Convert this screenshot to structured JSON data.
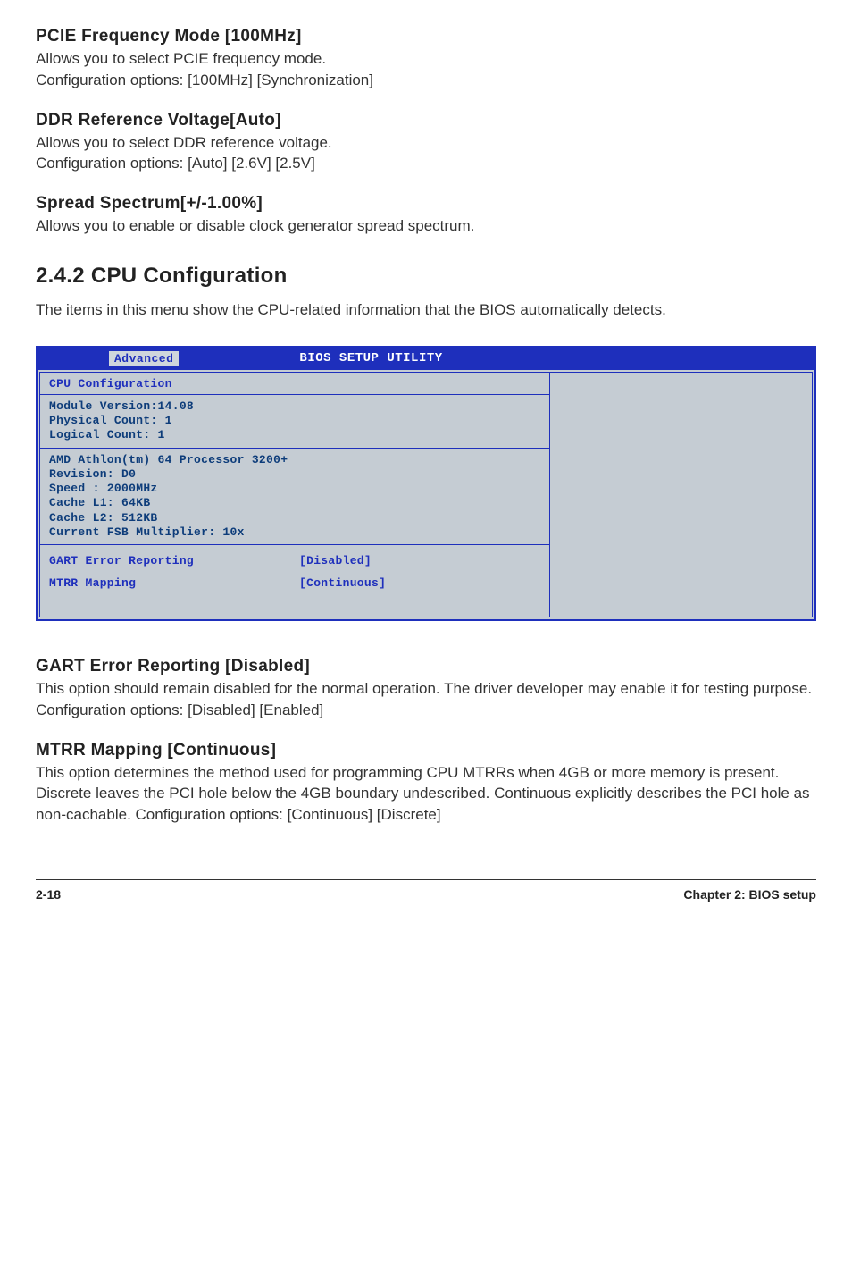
{
  "pcie": {
    "heading": "PCIE Frequency Mode [100MHz]",
    "body1": "Allows you to select PCIE frequency mode.",
    "body2": "Configuration options: [100MHz] [Synchronization]"
  },
  "ddr": {
    "heading": "DDR Reference Voltage[Auto]",
    "body1": "Allows you to select DDR reference voltage.",
    "body2": "Configuration options: [Auto] [2.6V] [2.5V]"
  },
  "spread": {
    "heading": "Spread Spectrum[+/-1.00%]",
    "body1": "Allows you to enable or disable clock generator spread spectrum."
  },
  "cpu_config": {
    "heading": "2.4.2   CPU Configuration",
    "body": "The items in this menu show the CPU-related information that the BIOS automatically detects."
  },
  "bios": {
    "tab": "Advanced",
    "title": "BIOS SETUP UTILITY",
    "panel_title": "CPU Configuration",
    "module_line1": "Module Version:14.08",
    "module_line2": "Physical Count: 1",
    "module_line3": "Logical Count: 1",
    "proc_line1": "AMD Athlon(tm) 64 Processor 3200+",
    "proc_line2": "Revision: D0",
    "proc_line3": "Speed   : 2000MHz",
    "proc_line4": "Cache L1: 64KB",
    "proc_line5": "Cache L2: 512KB",
    "proc_line6": "Current FSB Multiplier: 10x",
    "setting1_label": "GART Error Reporting",
    "setting1_value": "[Disabled]",
    "setting2_label": "MTRR Mapping",
    "setting2_value": "[Continuous]"
  },
  "gart": {
    "heading": "GART Error Reporting [Disabled]",
    "body": "This option should remain disabled for the normal operation. The driver developer may enable it for testing purpose. Configuration options: [Disabled] [Enabled]"
  },
  "mtrr": {
    "heading": "MTRR Mapping [Continuous]",
    "body": "This option determines the method used for programming CPU MTRRs when 4GB or more memory is present. Discrete leaves the PCI hole below the 4GB boundary undescribed. Continuous explicitly describes the PCI hole as non-cachable. Configuration options: [Continuous] [Discrete]"
  },
  "footer": {
    "page": "2-18",
    "chapter": "Chapter 2: BIOS setup"
  }
}
